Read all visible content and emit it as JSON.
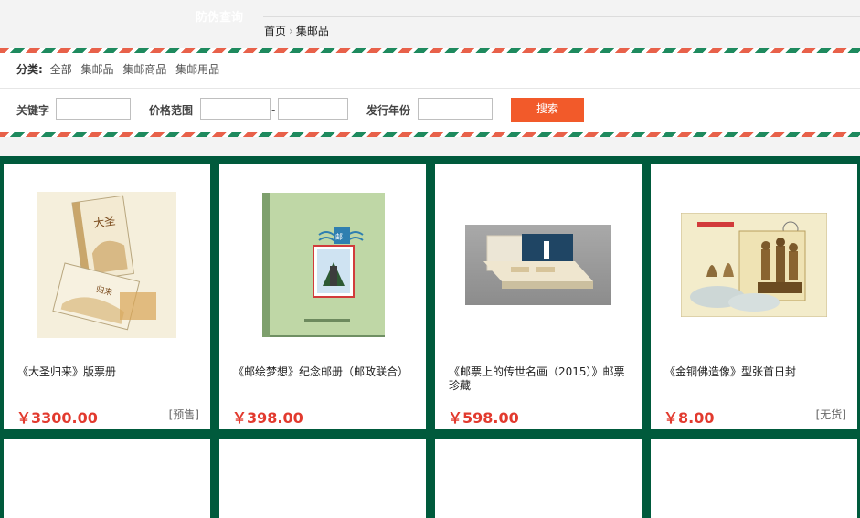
{
  "header": {
    "anti_fake": "防伪查询"
  },
  "breadcrumb": {
    "home": "首页",
    "separator": "›",
    "current": "集邮品"
  },
  "categories": {
    "label": "分类:",
    "items": [
      "全部",
      "集邮品",
      "集邮商品",
      "集邮用品"
    ]
  },
  "search": {
    "keyword_label": "关键字",
    "price_label": "价格范围",
    "price_dash": "-",
    "year_label": "发行年份",
    "button": "搜索",
    "keyword_value": "",
    "price_min_value": "",
    "price_max_value": "",
    "year_value": ""
  },
  "products": [
    {
      "name": "《大圣归来》版票册",
      "price": "￥3300.00",
      "stock": "[预售]"
    },
    {
      "name": "《邮绘梦想》纪念邮册（邮政联合）",
      "price": "￥398.00",
      "stock": ""
    },
    {
      "name": "《邮票上的传世名画（2015）》邮票珍藏",
      "price": "￥598.00",
      "stock": ""
    },
    {
      "name": "《金铜佛造像》型张首日封",
      "price": "￥8.00",
      "stock": "[无货]"
    }
  ],
  "colors": {
    "accent_button": "#f25a2a",
    "price": "#e23a2e",
    "grid_background": "#005a3c",
    "stripe_red": "#e8614a",
    "stripe_green": "#1e8a5e"
  }
}
